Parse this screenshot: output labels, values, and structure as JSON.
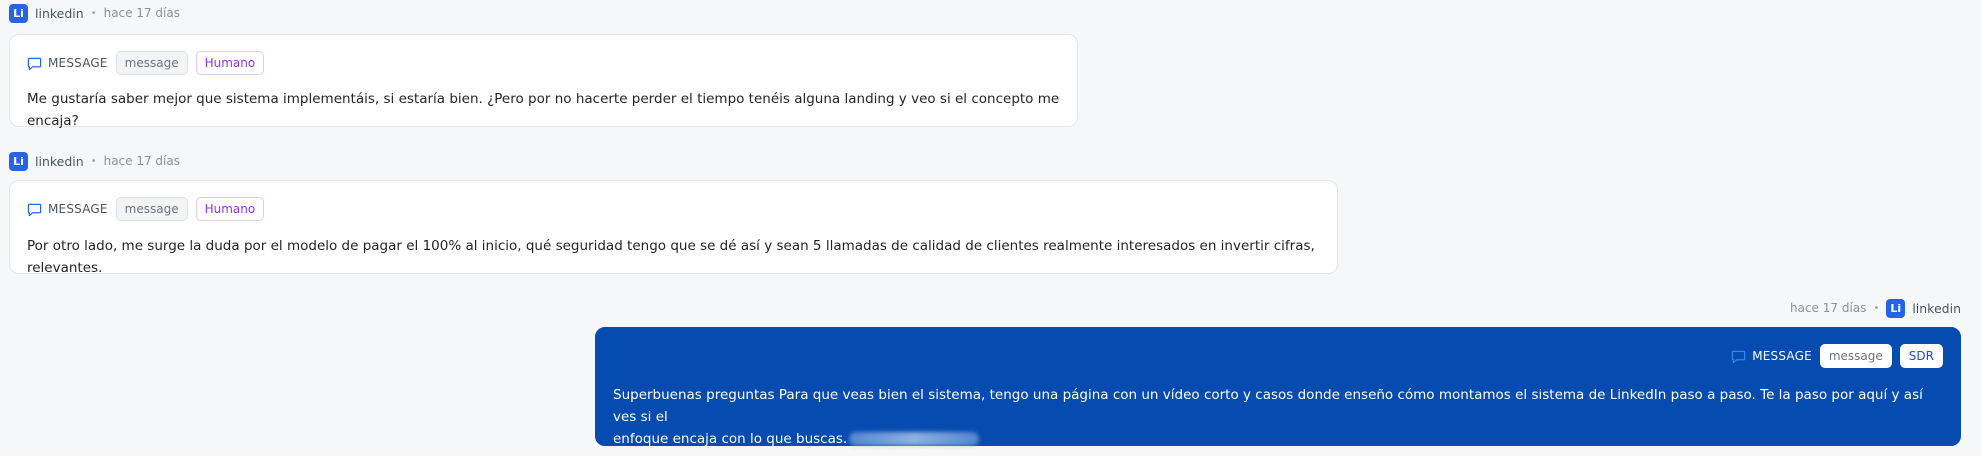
{
  "messages": [
    {
      "source": "linkedin",
      "source_badge": "Li",
      "time": "hace 17 días",
      "type_label": "MESSAGE",
      "channel_chip": "message",
      "author_chip": "Humano",
      "text": "Me gustaría saber mejor que sistema implementáis, si estaría bien. ¿Pero por no hacerte perder el tiempo tenéis alguna landing y veo si el concepto me encaja?"
    },
    {
      "source": "linkedin",
      "source_badge": "Li",
      "time": "hace 17 días",
      "type_label": "MESSAGE",
      "channel_chip": "message",
      "author_chip": "Humano",
      "text": "Por otro lado, me surge la duda por el modelo de pagar el 100% al inicio, qué seguridad tengo que se dé así y sean 5 llamadas de calidad de clientes realmente interesados en invertir cifras, relevantes."
    },
    {
      "source": "linkedin",
      "source_badge": "Li",
      "time": "hace 17 días",
      "type_label": "MESSAGE",
      "channel_chip": "message",
      "author_chip": "SDR",
      "text_line1": "Superbuenas preguntas Para que veas bien el sistema, tengo una página con un vídeo corto y casos donde enseño cómo montamos el sistema de LinkedIn paso a paso. Te la paso por aquí y así ves si el",
      "text_line2": "enfoque encaja con lo que buscas."
    }
  ],
  "colors": {
    "linkedin_badge": "#2563eb",
    "outgoing_bubble": "#054bb0",
    "human_chip": "#9333ea",
    "page_bg": "#f6f7f9"
  },
  "icons": {
    "message_type": "chat-bubble-icon"
  }
}
